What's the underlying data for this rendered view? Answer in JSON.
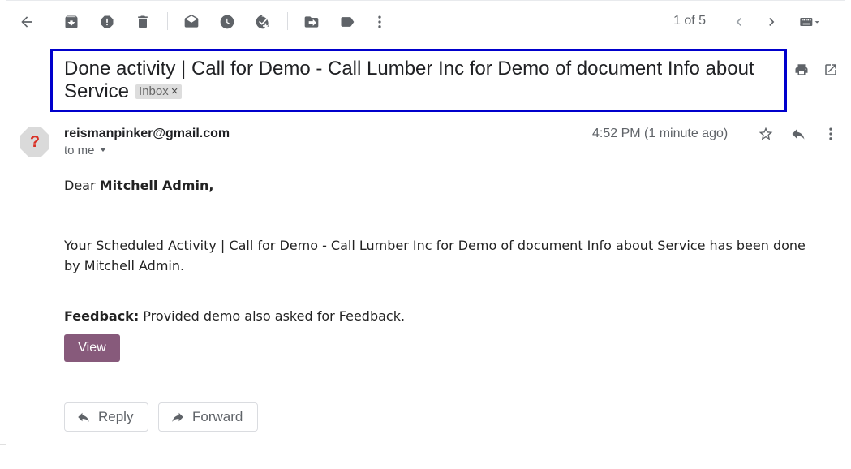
{
  "toolbar": {
    "pager": "1 of 5",
    "icons": [
      "back-arrow-icon",
      "archive-icon",
      "report-spam-icon",
      "delete-icon",
      "mark-unread-icon",
      "snooze-icon",
      "add-task-icon",
      "move-to-icon",
      "label-icon",
      "more-vert-icon",
      "older-icon",
      "newer-icon",
      "keyboard-icon"
    ]
  },
  "email": {
    "subject": "Done activity | Call for Demo - Call Lumber Inc for Demo of document Info about Service",
    "label": "Inbox",
    "label_remove": "×",
    "sender": "reismanpinker@gmail.com",
    "avatar_glyph": "?",
    "to": "to me",
    "time": "4:52 PM (1 minute ago)"
  },
  "body": {
    "greeting_prefix": "Dear ",
    "greeting_name": "Mitchell Admin,",
    "main": "Your Scheduled Activity | Call for Demo - Call Lumber Inc for Demo of document Info about Service has been done by Mitchell Admin.",
    "feedback_label": "Feedback:",
    "feedback_text": " Provided demo also asked for Feedback.",
    "view_button": "View"
  },
  "actions": {
    "reply": "Reply",
    "forward": "Forward"
  },
  "colors": {
    "accent_button": "#875a7b",
    "highlight_border": "#0000cc",
    "avatar_glyph": "#d93025"
  }
}
